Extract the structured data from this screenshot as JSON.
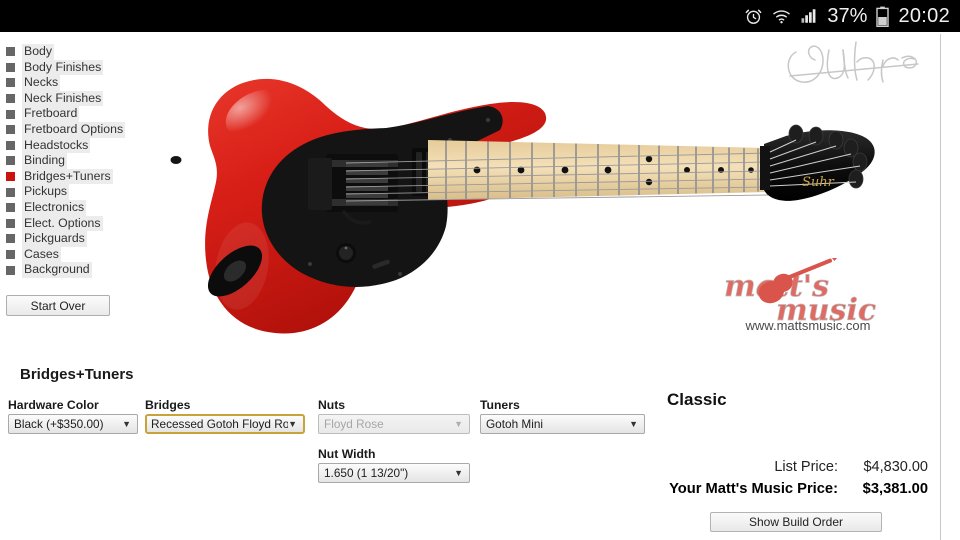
{
  "statusbar": {
    "alarm_icon": "alarm-clock-icon",
    "wifi_icon": "wifi-icon",
    "signal_icon": "cellular-signal-icon",
    "battery_percent": "37%",
    "battery_icon": "battery-icon",
    "clock": "20:02"
  },
  "sidebar": {
    "items": [
      {
        "label": "Body",
        "active": false
      },
      {
        "label": "Body Finishes",
        "active": false
      },
      {
        "label": "Necks",
        "active": false
      },
      {
        "label": "Neck Finishes",
        "active": false
      },
      {
        "label": "Fretboard",
        "active": false
      },
      {
        "label": "Fretboard Options",
        "active": false
      },
      {
        "label": "Headstocks",
        "active": false
      },
      {
        "label": "Binding",
        "active": false
      },
      {
        "label": "Bridges+Tuners",
        "active": true
      },
      {
        "label": "Pickups",
        "active": false
      },
      {
        "label": "Electronics",
        "active": false
      },
      {
        "label": "Elect. Options",
        "active": false
      },
      {
        "label": "Pickguards",
        "active": false
      },
      {
        "label": "Cases",
        "active": false
      },
      {
        "label": "Background",
        "active": false
      }
    ],
    "start_over_label": "Start Over"
  },
  "stage": {
    "brand_watermark": "Suhr",
    "store_logo_text": "matt's music",
    "store_url": "www.mattsmusic.com",
    "guitar": {
      "body_color": "#d81f17",
      "pickguard_color": "#141414",
      "fretboard_color": "#f0d9ab",
      "headstock_color": "#101010",
      "headstock_logo": "Suhr"
    }
  },
  "config": {
    "section_title": "Bridges+Tuners",
    "fields": [
      {
        "label": "Hardware Color",
        "value": "Black (+$350.00)",
        "state": "normal"
      },
      {
        "label": "Bridges",
        "value": "Recessed Gotoh Floyd Rose",
        "state": "focused"
      },
      {
        "label": "Nuts",
        "value": "Floyd Rose",
        "state": "disabled"
      },
      {
        "label": "Tuners",
        "value": "Gotoh Mini",
        "state": "normal"
      },
      {
        "label": "Nut Width",
        "value": "1.650 (1 13/20\")",
        "state": "normal"
      }
    ],
    "caret_glyph": "▼"
  },
  "pricing": {
    "model_name": "Classic",
    "list_price_label": "List Price:",
    "list_price_value": "$4,830.00",
    "your_price_label": "Your Matt's Music Price:",
    "your_price_value": "$3,381.00",
    "show_build_label": "Show Build Order"
  },
  "colors": {
    "accent_red": "#cc1111",
    "focus_gold": "#c8a33c",
    "guitar_red": "#d81f17",
    "statusbar_bg": "#000000"
  }
}
